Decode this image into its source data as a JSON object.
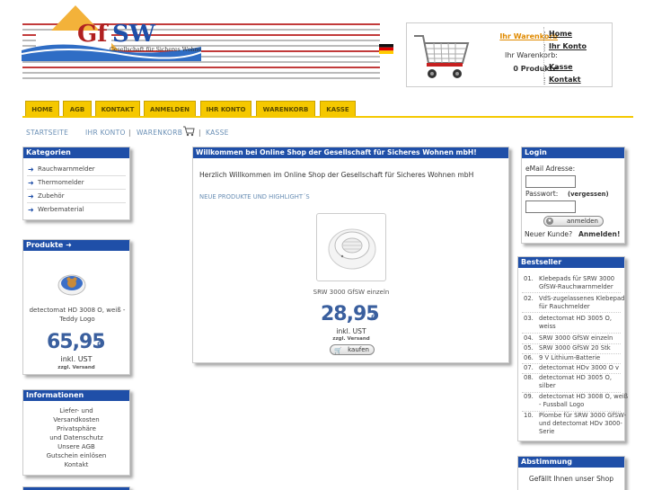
{
  "header": {
    "logo_text": "GfSW",
    "logo_tagline": "Gesellschaft für Sicheres Wohnen",
    "cart_link": "Ihr Warenkorb",
    "cart_label": "Ihr Warenkorb:",
    "cart_count": "0 Produkte",
    "account_links": [
      "Home",
      "Ihr Konto",
      "Kasse",
      "Kontakt"
    ]
  },
  "nav": {
    "tabs": [
      "HOME",
      "AGB",
      "KONTAKT",
      "ANMELDEN",
      "IHR KONTO",
      "WARENKORB",
      "KASSE"
    ]
  },
  "breadcrumb": {
    "items": [
      "STARTSEITE",
      "IHR KONTO",
      "WARENKORB",
      "KASSE"
    ],
    "separator": "|"
  },
  "categories": {
    "title": "Kategorien",
    "items": [
      "Rauchwarnmelder",
      "Thermomelder",
      "Zubehör",
      "Werbematerial"
    ]
  },
  "products_box": {
    "title": "Produkte",
    "product_name": "detectomat HD 3008 O, weiß - Teddy Logo",
    "price": "65,95",
    "currency": "€",
    "tax": "inkl. UST",
    "shipping": "zzgl. Versand"
  },
  "info_box": {
    "title": "Informationen",
    "links": [
      "Liefer- und",
      "Versandkosten",
      "Privatsphäre",
      "und Datenschutz",
      "Unsere AGB",
      "Gutschein einlösen",
      "Kontakt"
    ]
  },
  "main": {
    "title": "Willkommen bei Online Shop der Gesellschaft für Sicheres Wohnen mbH!",
    "welcome": "Herzlich Willkommen im Online Shop der Gesellschaft für Sicheres Wohnen mbH",
    "section_title": "NEUE PRODUKTE UND HIGHLIGHT´S",
    "product_name": "SRW 3000 GfSW einzeln",
    "price": "28,95",
    "currency": "€",
    "tax": "inkl. UST",
    "shipping": "zzgl. Versand",
    "buy_button": "kaufen"
  },
  "login": {
    "title": "Login",
    "email_label": "eMail Adresse:",
    "password_label": "Passwort:",
    "forgot_link": "(vergessen)",
    "login_button": "anmelden",
    "new_customer": "Neuer Kunde?",
    "register_link": "Anmelden!"
  },
  "bestseller": {
    "title": "Bestseller",
    "items": [
      {
        "num": "01.",
        "name": "Klebepads für SRW 3000 GfSW-Rauchwarnmelder"
      },
      {
        "num": "02.",
        "name": "VdS-zugelassenes Klebepad für Rauchmelder"
      },
      {
        "num": "03.",
        "name": "detectomat HD 3005 O, weiss"
      },
      {
        "num": "04.",
        "name": "SRW 3000 GfSW einzeln"
      },
      {
        "num": "05.",
        "name": "SRW 3000 GfSW 20 Stk"
      },
      {
        "num": "06.",
        "name": "9 V Lithium-Batterie"
      },
      {
        "num": "07.",
        "name": "detectomat HDv 3000 O v"
      },
      {
        "num": "08.",
        "name": "detectomat HD 3005 O, silber"
      },
      {
        "num": "09.",
        "name": "detectomat HD 3008 O, weiß - Fussball Logo"
      },
      {
        "num": "10.",
        "name": "Plombe für SRW 3000 GfSW- und detectomat HDv 3000-Serie"
      }
    ]
  },
  "poll": {
    "title": "Abstimmung",
    "question": "Gefällt Ihnen unser Shop"
  },
  "colors": {
    "box_header": "#1f4fa8",
    "tab": "#f5c800",
    "price": "#3a5f9e",
    "cart_link": "#e08a00"
  }
}
